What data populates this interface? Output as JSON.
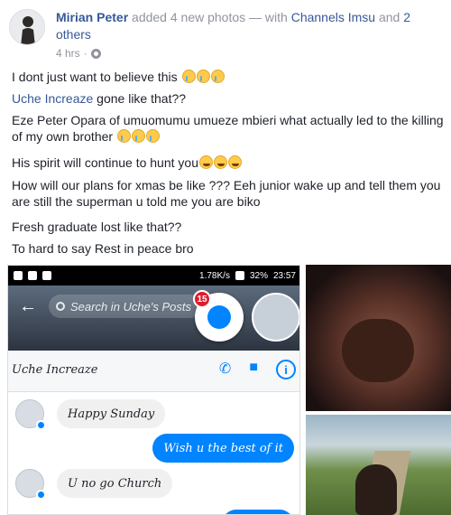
{
  "post": {
    "author": "Mirian Peter",
    "action": "added 4 new photos — with",
    "tagged": "Channels Imsu",
    "and_text": "and",
    "others": "2 others",
    "time": "4 hrs",
    "separator": "·",
    "lines": [
      "I dont just want to believe this",
      "Uche Increaze",
      "gone like that??",
      "Eze Peter Opara of umuomumu umueze mbieri what actually led to the killing of my own brother",
      "His spirit will continue to hunt you",
      "How will our plans for xmas be like ??? Eeh junior wake up and tell them you are still the superman u told me you are biko",
      "Fresh graduate lost like that??",
      "To hard to say Rest in peace bro"
    ]
  },
  "phone": {
    "status_speed": "1.78K/s",
    "status_battery": "32%",
    "status_time": "23:57",
    "search_placeholder": "Search in Uche's Posts",
    "badge_count": "15",
    "convo_name": "Uche Increaze",
    "messages": [
      {
        "dir": "in",
        "text": "Happy Sunday"
      },
      {
        "dir": "out",
        "text": "Wish u the best of it"
      },
      {
        "dir": "in",
        "text": "U no go Church"
      }
    ],
    "colors": {
      "messenger_blue": "#0084ff",
      "badge_red": "#e21b2c"
    }
  },
  "icons": [
    "globe-icon",
    "back-arrow-icon",
    "search-icon",
    "messenger-icon",
    "phone-icon",
    "video-icon",
    "info-icon"
  ],
  "colors": {
    "link": "#365899",
    "meta": "#90949c"
  }
}
